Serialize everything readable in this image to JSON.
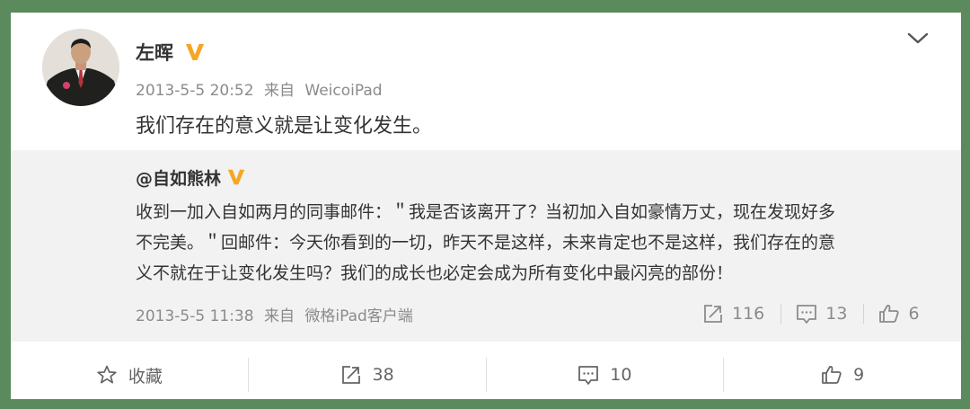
{
  "post": {
    "author": "左晖",
    "date": "2013-5-5 20:52",
    "via_label": "来自",
    "source": "WeicoiPad",
    "content": "我们存在的意义就是让变化发生。"
  },
  "repost": {
    "author": "@自如熊林",
    "text_lines": [
      "收到一加入自如两月的同事邮件：＂我是否该离开了？当初加入自如豪情万丈，现在发现好多",
      "不完美。＂回邮件：今天你看到的一切，昨天不是这样，未来肯定也不是这样，我们存在的意",
      "义不就在于让变化发生吗？我们的成长也必定会成为所有变化中最闪亮的部份！"
    ],
    "date": "2013-5-5 11:38",
    "via_label": "来自",
    "source": "微格iPad客户端",
    "repost_count": "116",
    "comment_count": "13",
    "like_count": "6"
  },
  "actions": {
    "favorite_label": "收藏",
    "repost_count": "38",
    "comment_count": "10",
    "like_count": "9"
  },
  "colors": {
    "background": "#5b8a5c",
    "verified": "#f5a623",
    "repost_bg": "#f2f2f2",
    "meta_text": "#8b8b8b"
  },
  "icons": {
    "verified": "verified-v-icon",
    "menu": "chevron-down-icon",
    "repost": "share-arrow-icon",
    "comment": "comment-icon",
    "like": "thumbs-up-icon",
    "favorite": "star-icon"
  }
}
